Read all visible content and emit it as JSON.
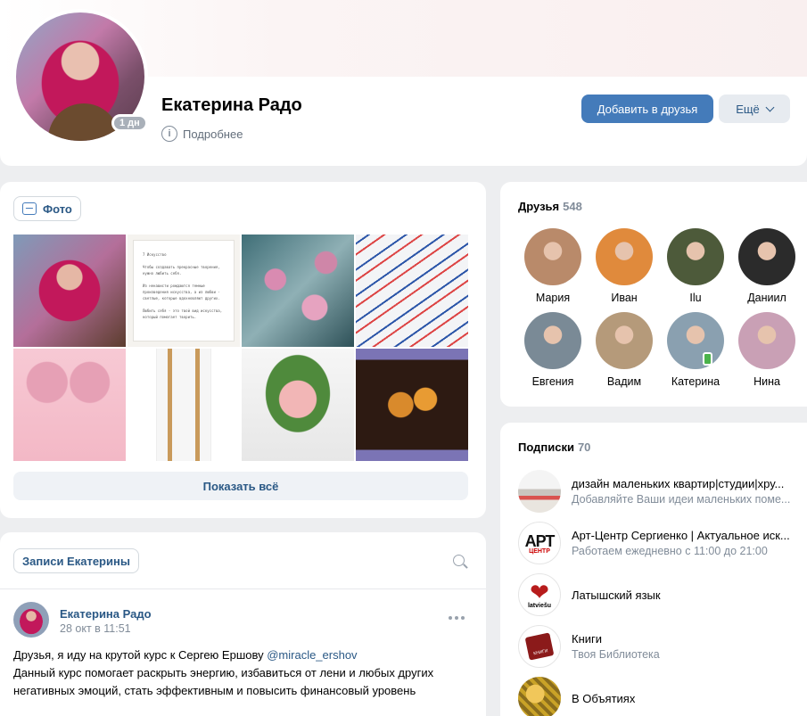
{
  "profile": {
    "name": "Екатерина Радо",
    "online_badge": "1 дн",
    "details_label": "Подробнее",
    "add_friend_label": "Добавить в друзья",
    "more_label": "Ещё"
  },
  "photos": {
    "tab_label": "Фото",
    "show_all_label": "Показать всё",
    "paper_lines": [
      "7 Искусство",
      "Чтобы создавать прекрасные творения, нужно любить себя.",
      "Из ненависти рождаются темные произведения искусства, а из любви - светлые, которые вдохновляют других.",
      "Любить себя - это твой вид искусства, который помогает творить."
    ]
  },
  "posts": {
    "tab_label": "Записи Екатерины",
    "items": [
      {
        "author": "Екатерина Радо",
        "time": "28 окт в 11:51",
        "text_before": "Друзья, я иду на крутой курс к Сергею Ершову ",
        "mention": "@miracle_ershov",
        "text_after": "Данный курс помогает раскрыть энергию, избавиться от лени и любых других негативных эмоций, стать эффективным и повысить финансовый уровень"
      }
    ]
  },
  "friends": {
    "title": "Друзья",
    "count": "548",
    "items": [
      {
        "name": "Мария",
        "color": "#b98a6a"
      },
      {
        "name": "Иван",
        "color": "#e08a3c"
      },
      {
        "name": "Ilu",
        "color": "#4d5a3a"
      },
      {
        "name": "Даниил",
        "color": "#2b2b2b"
      },
      {
        "name": "Евгения",
        "color": "#7a8a96"
      },
      {
        "name": "Вадим",
        "color": "#b59a7a"
      },
      {
        "name": "Катерина",
        "color": "#8aa0b0"
      },
      {
        "name": "Нина",
        "color": "#c9a0b5"
      }
    ]
  },
  "subscriptions": {
    "title": "Подписки",
    "count": "70",
    "items": [
      {
        "title": "дизайн маленьких квартир|студии|хру...",
        "desc": "Добавляйте Ваши идеи маленьких поме..."
      },
      {
        "title": "Арт-Центр Сергиенко | Актуальное иск...",
        "desc": "Работаем ежедневно с 11:00 до 21:00",
        "logo": "АРТ",
        "logo_sub": "ЦЕНТР"
      },
      {
        "title": "Латышский язык",
        "desc": "",
        "logo_sub": "latviešu"
      },
      {
        "title": "Книги",
        "desc": "Твоя Библиотека",
        "logo_sub": "КНИГИ"
      },
      {
        "title": "В Объятиях",
        "desc": ""
      }
    ]
  }
}
